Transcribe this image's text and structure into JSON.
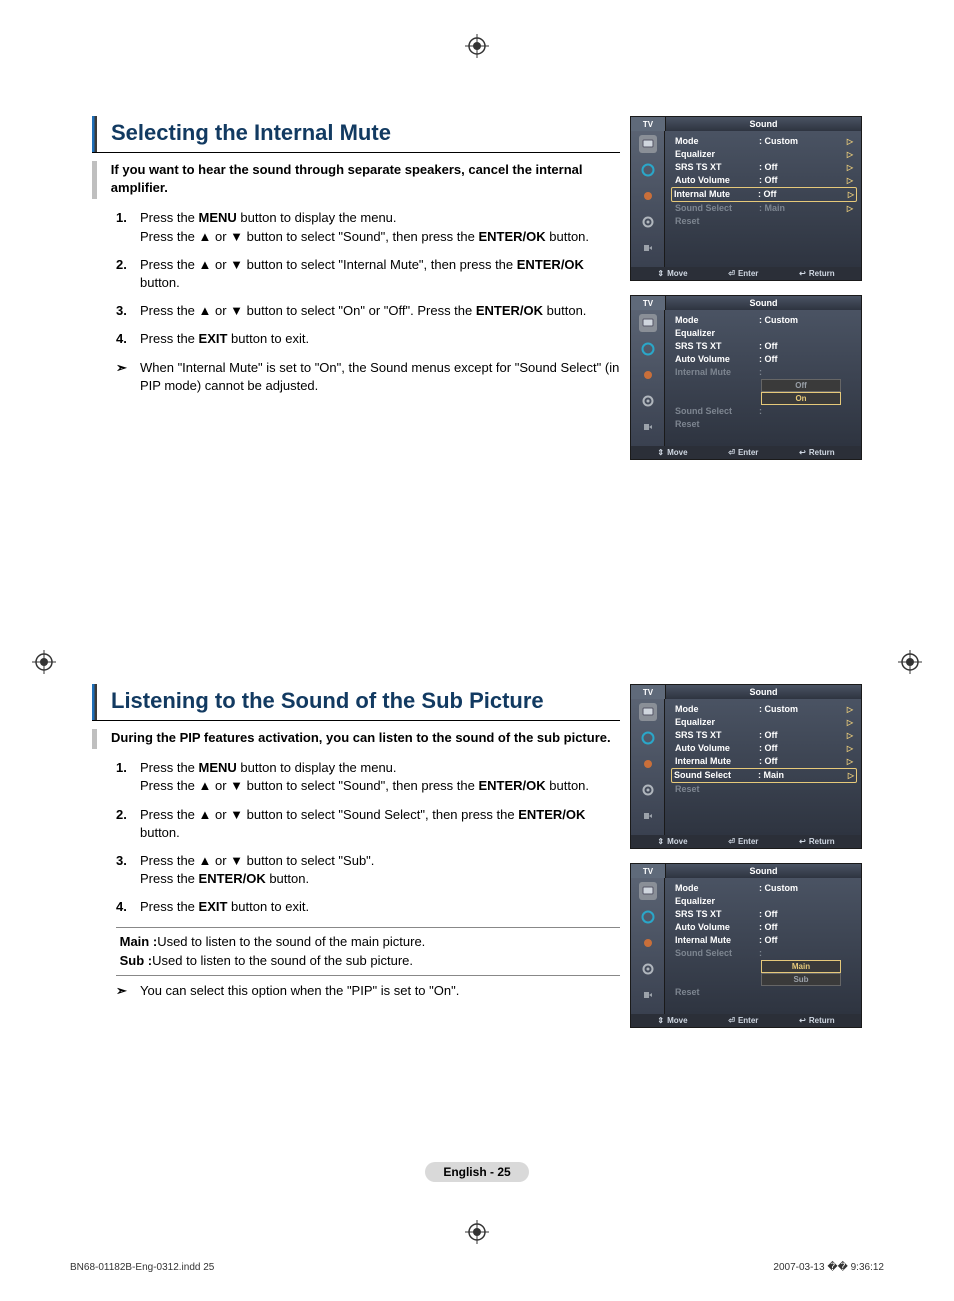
{
  "section1": {
    "heading": "Selecting the Internal Mute",
    "intro": "If you want to hear the sound through separate speakers, cancel the internal amplifier.",
    "steps": [
      {
        "n": "1.",
        "pre": "Press the ",
        "b1": "MENU",
        "mid1": " button to display the menu.\nPress the ▲ or ▼ button to select \"Sound\", then press the ",
        "b2": "ENTER/OK",
        "tail": " button."
      },
      {
        "n": "2.",
        "pre": "Press the ▲ or ▼ button to select \"Internal Mute\", then press the ",
        "b1": "ENTER/OK",
        "tail": " button."
      },
      {
        "n": "3.",
        "pre": "Press the ▲ or ▼ button to select \"On\" or \"Off\". Press the ",
        "b1": "ENTER/OK",
        "tail": " button."
      },
      {
        "n": "4.",
        "pre": "Press the ",
        "b1": "EXIT",
        "tail": " button to exit."
      }
    ],
    "note_marker": "➣",
    "note": "When \"Internal Mute\" is set to \"On\", the Sound menus except for \"Sound Select\" (in PIP mode) cannot be adjusted."
  },
  "section2": {
    "heading": "Listening to the Sound of the Sub Picture",
    "intro": "During the PIP features activation, you can listen to the sound of the sub picture.",
    "steps": [
      {
        "n": "1.",
        "pre": "Press the ",
        "b1": "MENU",
        "mid1": " button to display the menu.\nPress the ▲ or ▼ button to select \"Sound\", then press the ",
        "b2": "ENTER/OK",
        "tail": " button."
      },
      {
        "n": "2.",
        "pre": "Press the ▲ or ▼ button to select \"Sound Select\", then press the ",
        "b1": "ENTER/OK",
        "tail": " button."
      },
      {
        "n": "3.",
        "pre": "Press the ▲ or ▼ button to select \"Sub\".\nPress the ",
        "b1": "ENTER/OK",
        "tail": " button."
      },
      {
        "n": "4.",
        "pre": "Press the ",
        "b1": "EXIT",
        "tail": " button to exit."
      }
    ],
    "defs": [
      {
        "bullet": "",
        "label": "Main :",
        "text": " Used to listen to the sound of the main picture."
      },
      {
        "bullet": "",
        "label": "Sub :",
        "text": "  Used to listen to the sound of the sub picture."
      }
    ],
    "note_marker": "➣",
    "note": "You can select this option when the \"PIP\" is set to \"On\"."
  },
  "osd_common": {
    "tv": "TV",
    "title": "Sound",
    "labels": {
      "mode": "Mode",
      "eq": "Equalizer",
      "srs": "SRS TS XT",
      "av": "Auto Volume",
      "im": "Internal Mute",
      "ss": "Sound Select",
      "reset": "Reset"
    },
    "vals": {
      "custom": ": Custom",
      "off": ": Off",
      "main": ": Main",
      "colon": ":"
    },
    "footer": {
      "move": "Move",
      "enter": "Enter",
      "return": "Return",
      "updown": "⇕",
      "enter_icon": "⏎",
      "return_icon": "↩"
    }
  },
  "osd1a": {
    "selected": "im",
    "suboptions": null
  },
  "osd1b": {
    "selected": "im",
    "suboptions": [
      "Off",
      "On"
    ],
    "active_idx": 1
  },
  "osd2a": {
    "selected": "ss",
    "suboptions": null
  },
  "osd2b": {
    "selected": "ss",
    "suboptions": [
      "Main",
      "Sub"
    ],
    "active_idx": 0
  },
  "page_number": "English - 25",
  "footer_meta": {
    "left": "BN68-01182B-Eng-0312.indd   25",
    "right": "2007-03-13   �� 9:36:12"
  }
}
